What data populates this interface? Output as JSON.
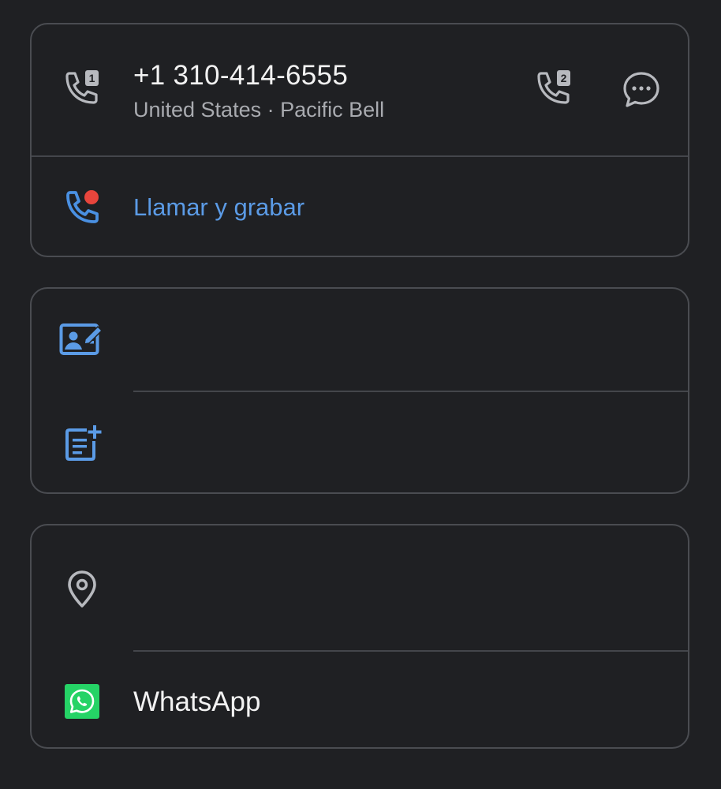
{
  "contact": {
    "phone_number": "+1 310-414-6555",
    "location_carrier": "United States · Pacific Bell",
    "sim1_call_icon": "phone-sim1-icon",
    "sim2_call_icon": "phone-sim2-icon",
    "message_icon": "chat-bubble-icon"
  },
  "call_record": {
    "label": "Llamar y grabar",
    "icon": "phone-record-icon"
  },
  "edit_section": {
    "edit_contact_icon": "contact-edit-icon",
    "add_note_icon": "note-add-icon"
  },
  "other_section": {
    "location_icon": "location-pin-icon",
    "whatsapp_label": "WhatsApp",
    "whatsapp_icon": "whatsapp-icon"
  },
  "colors": {
    "background": "#1f2023",
    "card_border": "#4a4c51",
    "accent_blue": "#5b9be6",
    "record_red": "#e8453c",
    "whatsapp_green": "#25d366",
    "primary_text": "#f2f2f2",
    "secondary_text": "#a9abb0"
  }
}
